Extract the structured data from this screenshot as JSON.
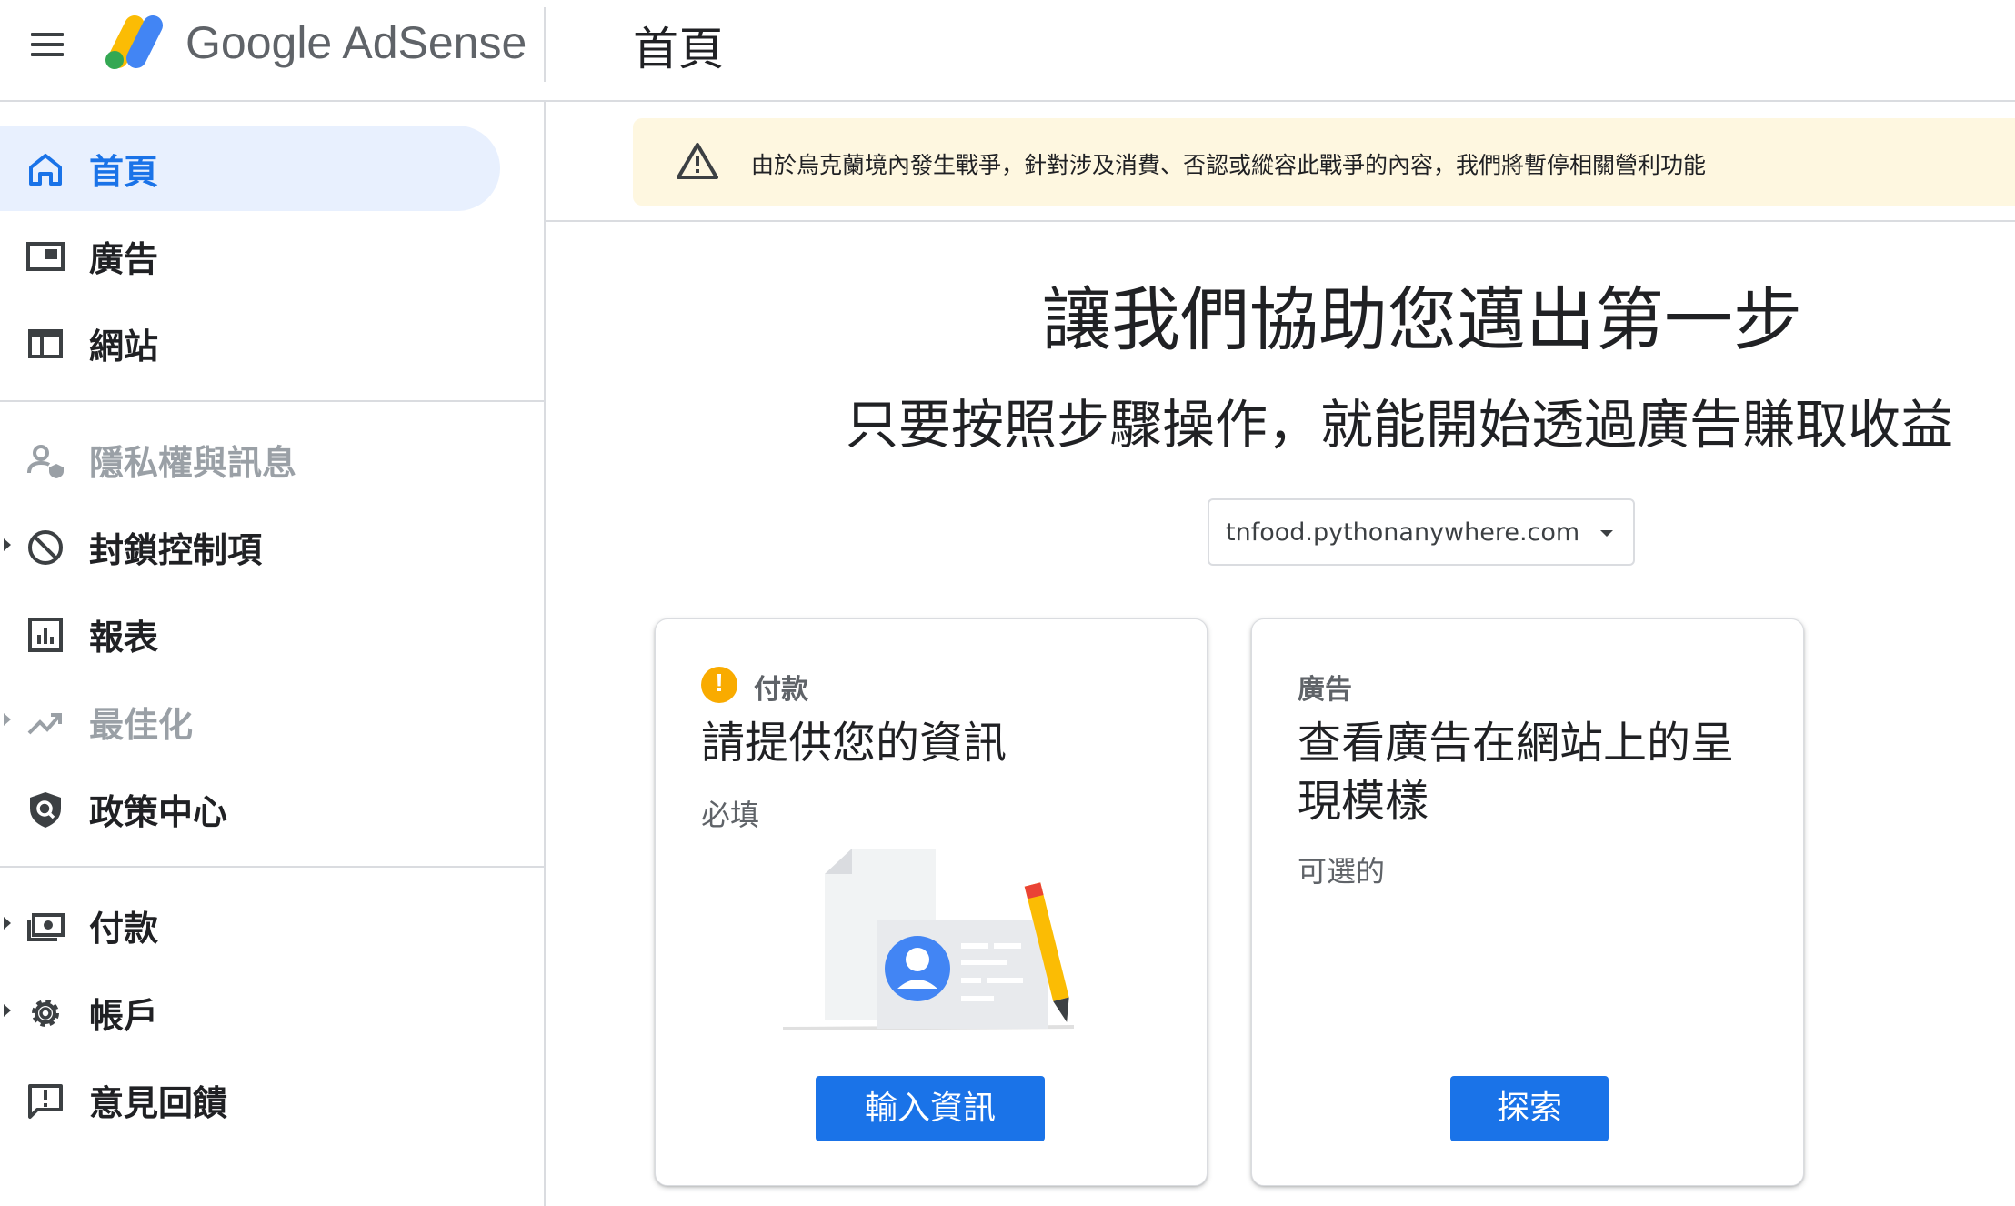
{
  "header": {
    "logo_text": "Google AdSense",
    "page_title": "首頁"
  },
  "sidebar": {
    "items": [
      {
        "label": "首頁",
        "icon": "home-icon",
        "active": true
      },
      {
        "label": "廣告",
        "icon": "ads-icon"
      },
      {
        "label": "網站",
        "icon": "sites-icon"
      },
      {
        "label": "隱私權與訊息",
        "icon": "privacy-icon",
        "disabled": true
      },
      {
        "label": "封鎖控制項",
        "icon": "block-icon",
        "expandable": true
      },
      {
        "label": "報表",
        "icon": "reports-icon"
      },
      {
        "label": "最佳化",
        "icon": "optimization-icon",
        "disabled": true,
        "expandable": true
      },
      {
        "label": "政策中心",
        "icon": "policy-shield-icon"
      },
      {
        "label": "付款",
        "icon": "payments-icon",
        "expandable": true
      },
      {
        "label": "帳戶",
        "icon": "gear-icon",
        "expandable": true
      },
      {
        "label": "意見回饋",
        "icon": "feedback-icon"
      }
    ]
  },
  "banner": {
    "text": "由於烏克蘭境內發生戰爭，針對涉及消費、否認或縱容此戰爭的內容，我們將暫停相關營利功能",
    "icon": "warning-triangle-icon",
    "color": "#fef7e0"
  },
  "hero": {
    "title": "讓我們協助您邁出第一步",
    "subtitle": "只要按照步驟操作，就能開始透過廣告賺取收益"
  },
  "site_selector": {
    "value": "tnfood.pythonanywhere.com"
  },
  "cards": {
    "payment": {
      "kicker": "付款",
      "heading": "請提供您的資訊",
      "status": "必填",
      "button": "輸入資訊",
      "icon": "alert-icon"
    },
    "ads": {
      "kicker": "廣告",
      "heading": "查看廣告在網站上的呈現模樣",
      "status": "可選的",
      "button": "探索"
    }
  },
  "colors": {
    "accent": "#1a73e8",
    "active_bg": "#e8f0fe",
    "warning": "#f9ab00"
  }
}
